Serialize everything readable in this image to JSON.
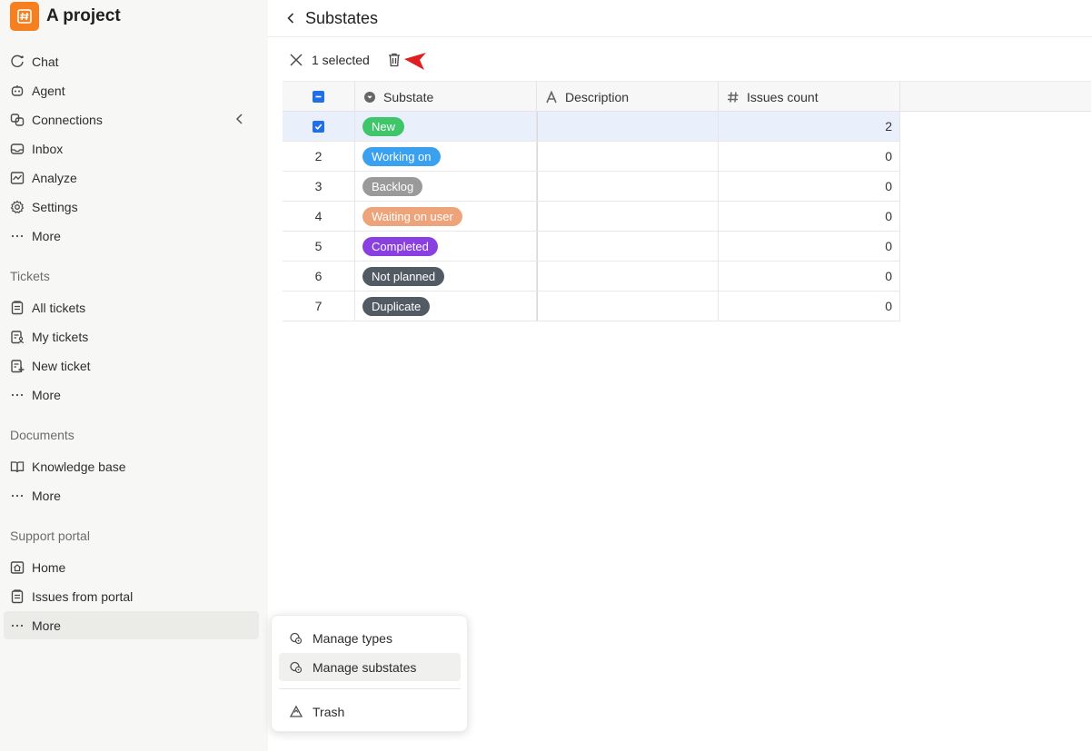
{
  "sidebar": {
    "project_name": "A project",
    "top_items": [
      {
        "label": "Chat",
        "icon": "chat-icon"
      },
      {
        "label": "Agent",
        "icon": "agent-icon"
      },
      {
        "label": "Connections",
        "icon": "connections-icon"
      },
      {
        "label": "Inbox",
        "icon": "inbox-icon"
      },
      {
        "label": "Analyze",
        "icon": "analyze-icon"
      },
      {
        "label": "Settings",
        "icon": "gear-icon"
      },
      {
        "label": "More",
        "icon": "more-icon"
      }
    ],
    "sections": [
      {
        "title": "Tickets",
        "items": [
          {
            "label": "All tickets",
            "icon": "list-icon"
          },
          {
            "label": "My tickets",
            "icon": "my-list-icon"
          },
          {
            "label": "New ticket",
            "icon": "new-list-icon"
          },
          {
            "label": "More",
            "icon": "more-icon"
          }
        ]
      },
      {
        "title": "Documents",
        "items": [
          {
            "label": "Knowledge base",
            "icon": "book-icon"
          },
          {
            "label": "More",
            "icon": "more-icon"
          }
        ]
      },
      {
        "title": "Support portal",
        "items": [
          {
            "label": "Home",
            "icon": "home-icon"
          },
          {
            "label": "Issues from portal",
            "icon": "list-icon"
          },
          {
            "label": "More",
            "icon": "more-icon"
          }
        ]
      }
    ]
  },
  "header": {
    "title": "Substates"
  },
  "toolbar": {
    "selected_text": "1 selected"
  },
  "table": {
    "columns": [
      "Substate",
      "Description",
      "Issues count"
    ],
    "rows": [
      {
        "index": "",
        "substate": "New",
        "color": "#3fc56a",
        "description": "",
        "count": "2",
        "selected": true
      },
      {
        "index": "2",
        "substate": "Working on",
        "color": "#3aa0f0",
        "description": "",
        "count": "0",
        "selected": false
      },
      {
        "index": "3",
        "substate": "Backlog",
        "color": "#9a9a9a",
        "description": "",
        "count": "0",
        "selected": false
      },
      {
        "index": "4",
        "substate": "Waiting on user",
        "color": "#eda47a",
        "description": "",
        "count": "0",
        "selected": false
      },
      {
        "index": "5",
        "substate": "Completed",
        "color": "#8a3fe0",
        "description": "",
        "count": "0",
        "selected": false
      },
      {
        "index": "6",
        "substate": "Not planned",
        "color": "#525a63",
        "description": "",
        "count": "0",
        "selected": false
      },
      {
        "index": "7",
        "substate": "Duplicate",
        "color": "#525a63",
        "description": "",
        "count": "0",
        "selected": false
      }
    ]
  },
  "menu": {
    "items": [
      {
        "label": "Manage types",
        "icon": "manage-types-icon"
      },
      {
        "label": "Manage substates",
        "icon": "manage-substates-icon"
      },
      {
        "label": "Trash",
        "icon": "trash-icon"
      }
    ]
  },
  "colors": {
    "accent": "#f6801f",
    "checkbox": "#1f6feb",
    "pointer": "#e02020"
  }
}
